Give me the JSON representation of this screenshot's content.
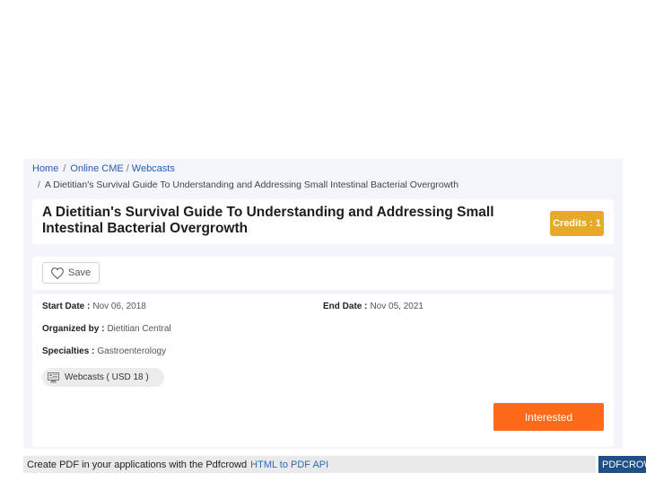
{
  "breadcrumb": {
    "home": "Home",
    "separator": "/",
    "online_cme": "Online CME",
    "webcasts": "Webcasts",
    "current": "A Dietitian's Survival Guide To Understanding and Addressing Small Intestinal Bacterial Overgrowth"
  },
  "course": {
    "title": "A Dietitian's Survival Guide To Understanding and Addressing Small Intestinal Bacterial Overgrowth",
    "credits": "Credits : 1"
  },
  "actions": {
    "save_label": "Save",
    "interested_label": "Interested"
  },
  "details": {
    "start_date_label": "Start Date :",
    "start_date": "Nov 06, 2018",
    "end_date_label": "End Date :",
    "end_date": "Nov 05, 2021",
    "organized_by_label": "Organized by :",
    "organized_by": "Dietitian Central",
    "specialties_label": "Specialties :",
    "specialties": "Gastroenterology",
    "format_chip": "Webcasts ( USD 18 )"
  },
  "footer": {
    "text": "Create PDF in your applications with the Pdfcrowd",
    "link": "HTML to PDF API",
    "brand": "PDFCROWD"
  },
  "colors": {
    "credits_badge": "#e6a92a",
    "interested_button": "#ff6a1a",
    "link": "#2a5db0",
    "panel_bg": "#f3f5fb"
  },
  "icons": {
    "save": "heart-icon",
    "format_chip": "webcast-icon"
  }
}
